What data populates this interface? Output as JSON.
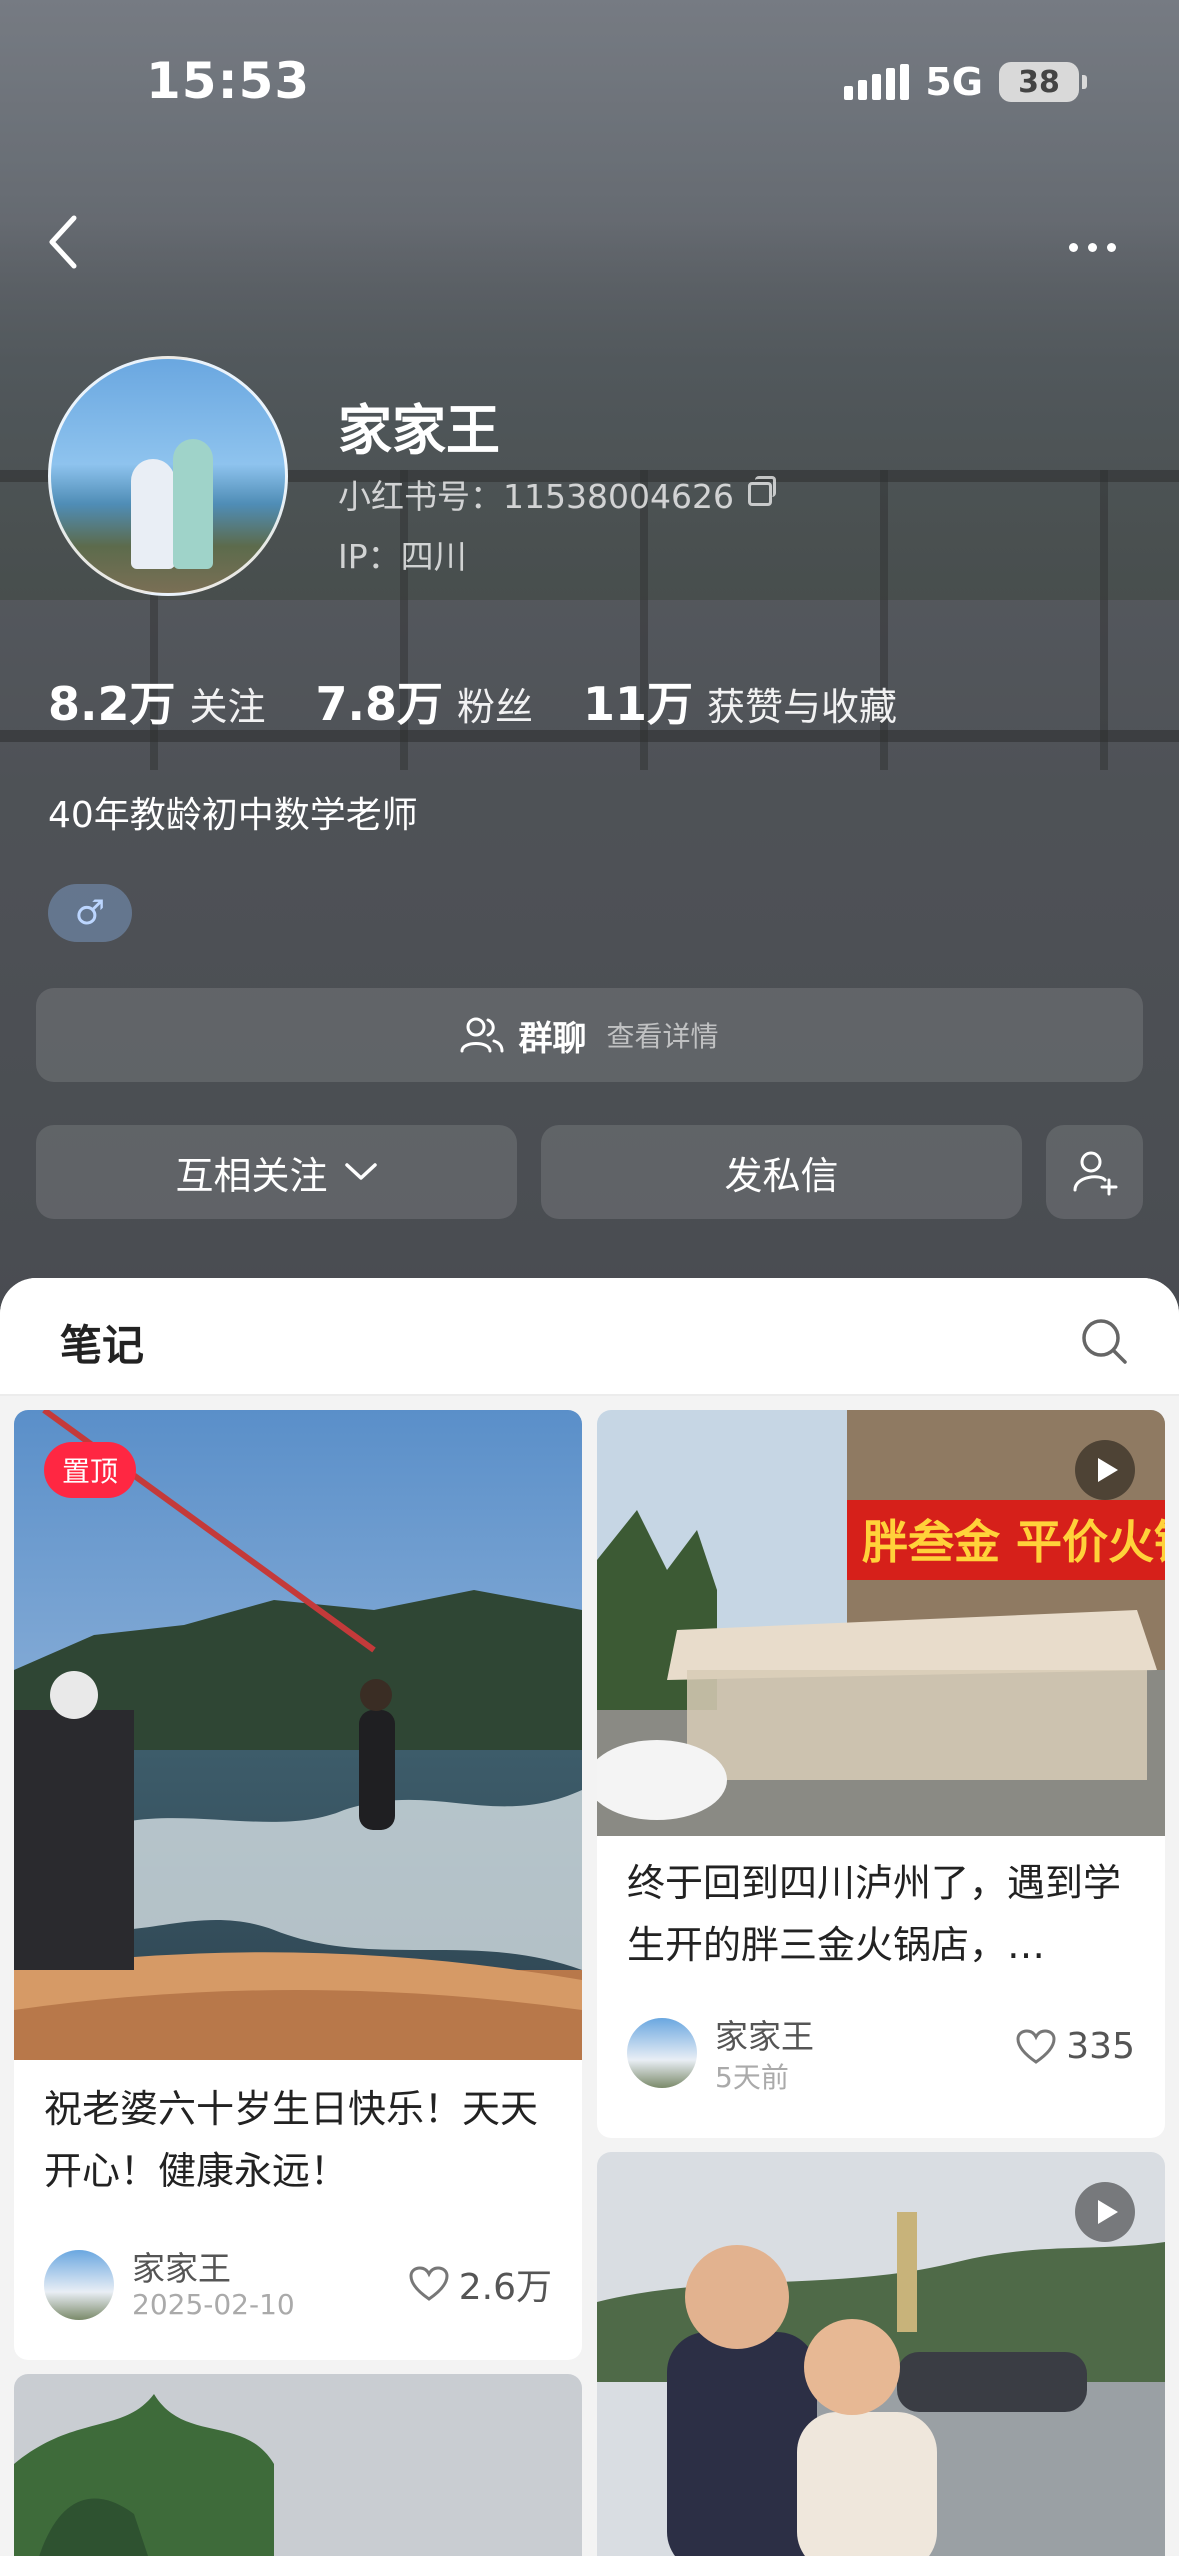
{
  "status_bar": {
    "time": "15:53",
    "network": "5G",
    "battery": "38"
  },
  "profile": {
    "nickname": "家家王",
    "red_id": "小红书号：11538004626",
    "ip": "IP：四川",
    "stats": [
      {
        "num": "8.2万",
        "label": "关注"
      },
      {
        "num": "7.8万",
        "label": "粉丝"
      },
      {
        "num": "11万",
        "label": "获赞与收藏"
      }
    ],
    "bio": "40年教龄初中数学老师",
    "gender_symbol": "♂"
  },
  "group_chat": {
    "title": "群聊",
    "subtitle": "查看详情"
  },
  "actions": {
    "follow": "互相关注",
    "message": "发私信"
  },
  "notes_tab": {
    "label": "笔记"
  },
  "notes": [
    {
      "title": "祝老婆六十岁生日快乐！天天开心！健康永远！",
      "author": "家家王",
      "date": "2025-02-10",
      "likes": "2.6万",
      "pinned": "置顶"
    },
    {
      "title": "终于回到四川泸州了，遇到学生开的胖三金火锅店，…",
      "author": "家家王",
      "date": "5天前",
      "likes": "335",
      "sign_text": "胖叁金 平价火锅"
    }
  ],
  "colors": {
    "pin_red": "#ff2742",
    "sheet_bg": "#f3f3f3"
  }
}
